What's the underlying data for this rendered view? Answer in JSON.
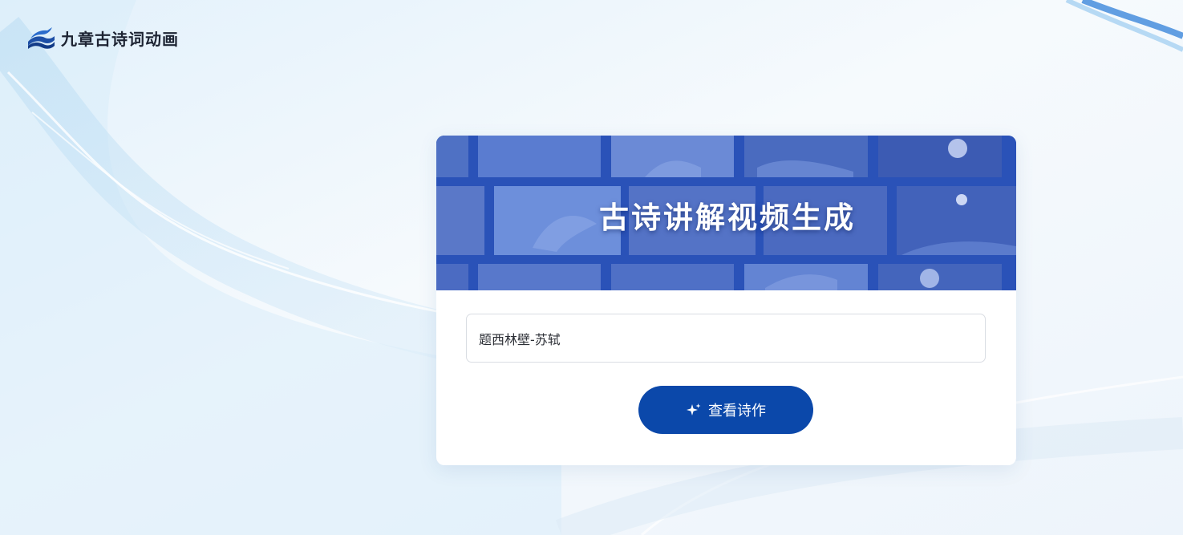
{
  "app": {
    "logo_icon": "book-wave-logo-icon",
    "logo_text": "九章古诗词动画"
  },
  "card": {
    "banner_title": "古诗讲解视频生成",
    "input": {
      "value": "题西林壁-苏轼",
      "placeholder": ""
    },
    "submit_button": {
      "icon": "sparkle-icon",
      "label": "查看诗作"
    }
  },
  "colors": {
    "brand_blue": "#0b48aa",
    "banner_blue": "#2a52b8",
    "page_background": "#eef6fc"
  }
}
